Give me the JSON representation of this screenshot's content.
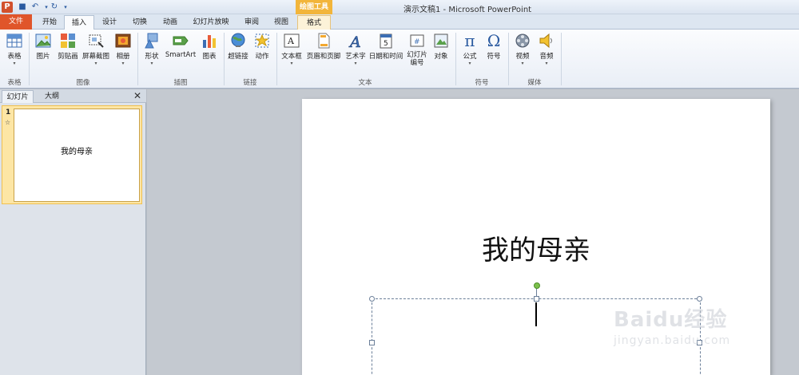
{
  "window": {
    "title": "演示文稿1 - Microsoft PowerPoint",
    "context_group": "绘图工具"
  },
  "tabs": [
    "文件",
    "开始",
    "插入",
    "设计",
    "切换",
    "动画",
    "幻灯片放映",
    "审阅",
    "视图",
    "格式"
  ],
  "ribbon": {
    "groups": [
      {
        "label": "表格",
        "buttons": [
          "表格"
        ]
      },
      {
        "label": "图像",
        "buttons": [
          "图片",
          "剪贴画",
          "屏幕截图",
          "相册"
        ]
      },
      {
        "label": "插图",
        "buttons": [
          "形状",
          "SmartArt",
          "图表"
        ]
      },
      {
        "label": "链接",
        "buttons": [
          "超链接",
          "动作"
        ]
      },
      {
        "label": "文本",
        "buttons": [
          "文本框",
          "页眉和页脚",
          "艺术字",
          "日期和时间",
          "幻灯片\n编号",
          "对象"
        ]
      },
      {
        "label": "符号",
        "buttons": [
          "公式",
          "符号"
        ]
      },
      {
        "label": "媒体",
        "buttons": [
          "视频",
          "音频"
        ]
      }
    ]
  },
  "left_panel": {
    "tabs": [
      "幻灯片",
      "大纲"
    ],
    "slide_number": "1",
    "thumb_title": "我的母亲"
  },
  "slide": {
    "title": "我的母亲"
  },
  "watermark": {
    "logo": "Baidu经验",
    "sub": "jingyan.baidu.com"
  },
  "colors": {
    "file_tab": "#e0552a",
    "context_tab": "#f2b53b",
    "selection_thumb": "#fde6a5",
    "rotation_handle": "#7cc04b"
  }
}
